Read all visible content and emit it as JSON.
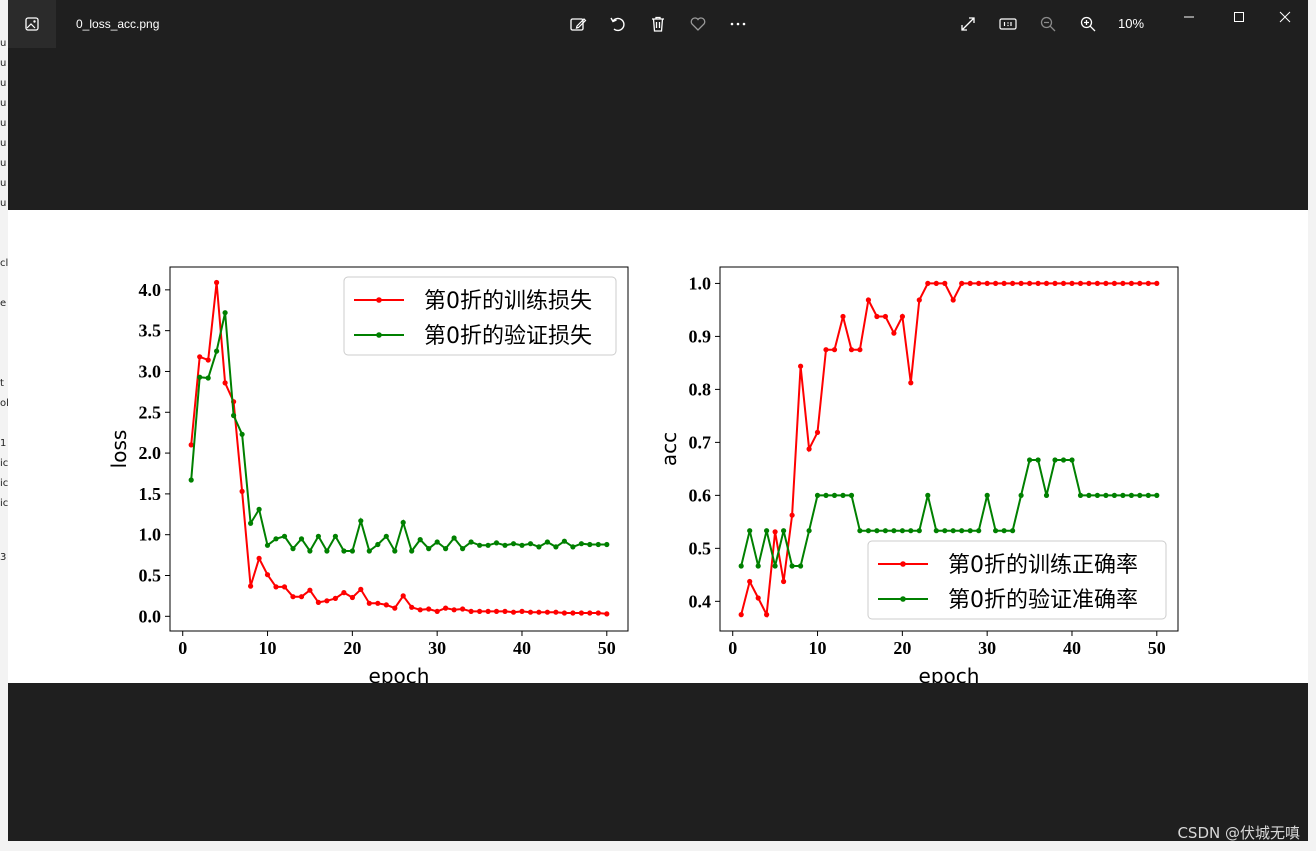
{
  "window": {
    "file_name": "0_loss_acc.png",
    "zoom_level": "10%",
    "watermark": "CSDN @伏城无嗔"
  },
  "background_fragments": [
    "u",
    "u",
    "u",
    "u",
    "u",
    "u",
    "u",
    "u",
    "u",
    "cl",
    "e",
    "t",
    "ol",
    "1",
    "ic",
    "ic",
    "ic",
    "3"
  ],
  "icons": {
    "app": "photo-app-icon",
    "edit": "edit-image-icon",
    "rotate": "rotate-icon",
    "delete": "trash-icon",
    "favorite": "heart-icon",
    "more": "more-icon",
    "fullscreen": "expand-icon",
    "actual_size": "actual-size-icon",
    "zoom_out": "zoom-out-icon",
    "zoom_in": "zoom-in-icon",
    "minimize": "minimize-icon",
    "maximize": "maximize-icon",
    "close": "close-icon"
  },
  "colors": {
    "window_bg": "#1f1f1f",
    "train": "#ff0000",
    "val": "#008000"
  },
  "chart_data": [
    {
      "type": "line",
      "title": "",
      "xlabel": "epoch",
      "ylabel": "loss",
      "xlim": [
        -1.5,
        52.5
      ],
      "ylim": [
        -0.18,
        4.28
      ],
      "xticks": [
        0,
        10,
        20,
        30,
        40,
        50
      ],
      "yticks": [
        0.0,
        0.5,
        1.0,
        1.5,
        2.0,
        2.5,
        3.0,
        3.5,
        4.0
      ],
      "ytick_labels": [
        "0.0",
        "0.5",
        "1.0",
        "1.5",
        "2.0",
        "2.5",
        "3.0",
        "3.5",
        "4.0"
      ],
      "legend_position": "top-right",
      "grid": false,
      "x": [
        1,
        2,
        3,
        4,
        5,
        6,
        7,
        8,
        9,
        10,
        11,
        12,
        13,
        14,
        15,
        16,
        17,
        18,
        19,
        20,
        21,
        22,
        23,
        24,
        25,
        26,
        27,
        28,
        29,
        30,
        31,
        32,
        33,
        34,
        35,
        36,
        37,
        38,
        39,
        40,
        41,
        42,
        43,
        44,
        45,
        46,
        47,
        48,
        49,
        50
      ],
      "series": [
        {
          "name": "第0折的训练损失",
          "color": "#ff0000",
          "values": [
            2.1,
            3.18,
            3.14,
            4.09,
            2.86,
            2.63,
            1.53,
            0.37,
            0.71,
            0.51,
            0.36,
            0.36,
            0.24,
            0.24,
            0.32,
            0.17,
            0.19,
            0.22,
            0.29,
            0.23,
            0.33,
            0.16,
            0.16,
            0.14,
            0.1,
            0.25,
            0.11,
            0.08,
            0.09,
            0.06,
            0.1,
            0.08,
            0.09,
            0.06,
            0.06,
            0.06,
            0.06,
            0.06,
            0.05,
            0.06,
            0.05,
            0.05,
            0.05,
            0.05,
            0.04,
            0.04,
            0.04,
            0.04,
            0.04,
            0.03
          ]
        },
        {
          "name": "第0折的验证损失",
          "color": "#008000",
          "values": [
            1.67,
            2.93,
            2.92,
            3.25,
            3.72,
            2.46,
            2.23,
            1.14,
            1.31,
            0.87,
            0.95,
            0.98,
            0.83,
            0.95,
            0.8,
            0.98,
            0.8,
            0.98,
            0.8,
            0.8,
            1.17,
            0.8,
            0.88,
            0.98,
            0.8,
            1.15,
            0.8,
            0.94,
            0.83,
            0.91,
            0.83,
            0.96,
            0.83,
            0.91,
            0.87,
            0.87,
            0.9,
            0.87,
            0.89,
            0.87,
            0.89,
            0.85,
            0.91,
            0.85,
            0.92,
            0.85,
            0.89,
            0.88,
            0.88,
            0.88
          ]
        }
      ]
    },
    {
      "type": "line",
      "title": "",
      "xlabel": "epoch",
      "ylabel": "acc",
      "xlim": [
        -1.5,
        52.5
      ],
      "ylim": [
        0.344,
        1.031
      ],
      "xticks": [
        0,
        10,
        20,
        30,
        40,
        50
      ],
      "yticks": [
        0.4,
        0.5,
        0.6,
        0.7,
        0.8,
        0.9,
        1.0
      ],
      "ytick_labels": [
        "0.4",
        "0.5",
        "0.6",
        "0.7",
        "0.8",
        "0.9",
        "1.0"
      ],
      "legend_position": "bottom-right",
      "grid": false,
      "x": [
        1,
        2,
        3,
        4,
        5,
        6,
        7,
        8,
        9,
        10,
        11,
        12,
        13,
        14,
        15,
        16,
        17,
        18,
        19,
        20,
        21,
        22,
        23,
        24,
        25,
        26,
        27,
        28,
        29,
        30,
        31,
        32,
        33,
        34,
        35,
        36,
        37,
        38,
        39,
        40,
        41,
        42,
        43,
        44,
        45,
        46,
        47,
        48,
        49,
        50
      ],
      "series": [
        {
          "name": "第0折的训练正确率",
          "color": "#ff0000",
          "values": [
            0.375,
            0.4375,
            0.40625,
            0.375,
            0.53125,
            0.4375,
            0.5625,
            0.84375,
            0.6875,
            0.71875,
            0.875,
            0.875,
            0.9375,
            0.875,
            0.875,
            0.96875,
            0.9375,
            0.9375,
            0.90625,
            0.9375,
            0.8125,
            0.96875,
            1.0,
            1.0,
            1.0,
            0.96875,
            1.0,
            1.0,
            1.0,
            1.0,
            1.0,
            1.0,
            1.0,
            1.0,
            1.0,
            1.0,
            1.0,
            1.0,
            1.0,
            1.0,
            1.0,
            1.0,
            1.0,
            1.0,
            1.0,
            1.0,
            1.0,
            1.0,
            1.0,
            1.0
          ]
        },
        {
          "name": "第0折的验证准确率",
          "color": "#008000",
          "values": [
            0.4667,
            0.5333,
            0.4667,
            0.5333,
            0.4667,
            0.5333,
            0.4667,
            0.4667,
            0.5333,
            0.6,
            0.6,
            0.6,
            0.6,
            0.6,
            0.5333,
            0.5333,
            0.5333,
            0.5333,
            0.5333,
            0.5333,
            0.5333,
            0.5333,
            0.6,
            0.5333,
            0.5333,
            0.5333,
            0.5333,
            0.5333,
            0.5333,
            0.6,
            0.5333,
            0.5333,
            0.5333,
            0.6,
            0.6667,
            0.6667,
            0.6,
            0.6667,
            0.6667,
            0.6667,
            0.6,
            0.6,
            0.6,
            0.6,
            0.6,
            0.6,
            0.6,
            0.6,
            0.6,
            0.6
          ]
        }
      ]
    }
  ]
}
